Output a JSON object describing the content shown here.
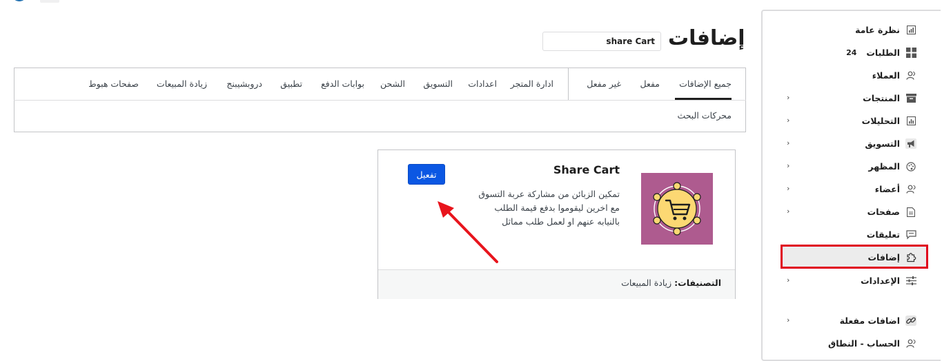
{
  "header": {
    "page_title": "إضافات",
    "search_value": "share Cart"
  },
  "sidebar": {
    "items": [
      {
        "label": "نظرة عامة",
        "icon": "chart-icon",
        "chevron": false
      },
      {
        "label": "الطلبات",
        "icon": "orders-grid-icon",
        "chevron": false,
        "count": "24"
      },
      {
        "label": "العملاء",
        "icon": "users-icon",
        "chevron": false
      },
      {
        "label": "المنتجات",
        "icon": "box-icon",
        "chevron": true
      },
      {
        "label": "التحليلات",
        "icon": "analytics-icon",
        "chevron": true
      },
      {
        "label": "التسويق",
        "icon": "megaphone-icon",
        "chevron": true
      },
      {
        "label": "المظهر",
        "icon": "palette-icon",
        "chevron": true
      },
      {
        "label": "أعضاء",
        "icon": "members-icon",
        "chevron": true
      },
      {
        "label": "صفحات",
        "icon": "page-icon",
        "chevron": true
      },
      {
        "label": "تعليقات",
        "icon": "comments-icon",
        "chevron": false
      },
      {
        "label": "إضافات",
        "icon": "puzzle-icon",
        "chevron": false,
        "active": true
      },
      {
        "label": "الإعدادات",
        "icon": "sliders-icon",
        "chevron": true
      },
      {
        "label": "اضافات مفعلة",
        "icon": "link-icon",
        "chevron": true
      },
      {
        "label": "الحساب - النطاق",
        "icon": "account-icon",
        "chevron": false
      }
    ]
  },
  "tabs": {
    "row1": [
      "جميع الإضافات",
      "مفعل",
      "غير مفعل",
      "ادارة المتجر",
      "اعدادات",
      "التسويق",
      "الشحن",
      "بوابات الدفع",
      "تطبيق",
      "دروبشيبنج",
      "زيادة المبيعات",
      "صفحات هبوط"
    ],
    "row2": [
      "محركات البحث"
    ],
    "active": "جميع الإضافات"
  },
  "plugin": {
    "title": "Share Cart",
    "description_lines": [
      "تمكين الزبائن من مشاركة عربة التسوق",
      "مع اخرين ليقوموا بدفع قيمة الطلب",
      "بالنيابه عنهم او لعمل طلب مماثل"
    ],
    "activate_label": "تفعيل",
    "categories_label": "التصنيفات:",
    "categories_value": "زيادة المبيعات",
    "thumb_icon": "shopping-cart-share-icon"
  },
  "colors": {
    "accent": "#0b57e3",
    "highlight": "#e0001b",
    "thumb_bg": "#ae5b8f",
    "thumb_circle": "#fcd873"
  }
}
